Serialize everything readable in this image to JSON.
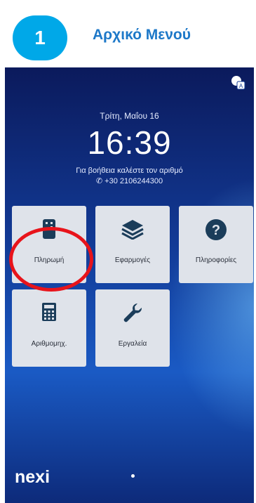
{
  "header": {
    "step_number": "1",
    "title": "Αρχικό Μενού"
  },
  "status": {
    "date": "Τρίτη, Μαΐου 16",
    "time": "16:39",
    "help_line1": "Για βοήθεια καλέστε τον αριθμό",
    "help_line2": "✆ +30 2106244300"
  },
  "tiles": [
    {
      "label": "Πληρωμή",
      "icon": "card-terminal-icon"
    },
    {
      "label": "Εφαρμογές",
      "icon": "layers-icon"
    },
    {
      "label": "Πληροφορίες",
      "icon": "help-icon"
    },
    {
      "label": "Αριθμομηχ.",
      "icon": "calculator-icon"
    },
    {
      "label": "Εργαλεία",
      "icon": "wrench-icon"
    }
  ],
  "brand": {
    "name": "nexi"
  },
  "colors": {
    "accent": "#00a8e8",
    "title": "#1d78c8",
    "highlight": "#e8141b",
    "icon": "#1b3d5a"
  }
}
